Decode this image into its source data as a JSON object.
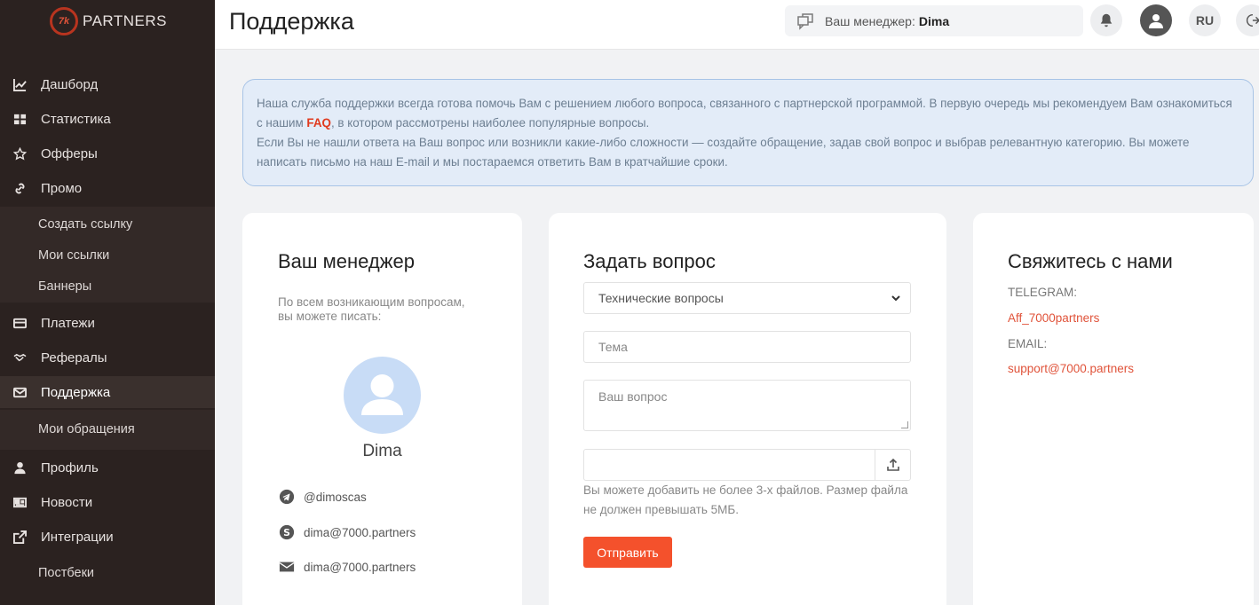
{
  "app": {
    "logo_mark": "7k",
    "logo_text": "PARTNERS"
  },
  "sidebar": {
    "items": [
      {
        "label": "Дашборд",
        "icon": "chart-line-icon"
      },
      {
        "label": "Статистика",
        "icon": "grid-icon"
      },
      {
        "label": "Офферы",
        "icon": "star-icon"
      },
      {
        "label": "Промо",
        "icon": "link-icon"
      },
      {
        "label": "Создать ссылку"
      },
      {
        "label": "Мои ссылки"
      },
      {
        "label": "Баннеры"
      },
      {
        "label": "Платежи",
        "icon": "credit-card-icon"
      },
      {
        "label": "Рефералы",
        "icon": "handshake-icon"
      },
      {
        "label": "Поддержка",
        "icon": "envelope-icon"
      },
      {
        "label": "Мои обращения"
      },
      {
        "label": "Профиль",
        "icon": "user-icon"
      },
      {
        "label": "Новости",
        "icon": "newspaper-icon"
      },
      {
        "label": "Интеграции",
        "icon": "share-icon"
      },
      {
        "label": "Постбеки"
      }
    ]
  },
  "header": {
    "title": "Поддержка",
    "manager_label": "Ваш менеджер:",
    "manager_name": "Dima",
    "lang": "RU"
  },
  "info": {
    "line1_start": "Наша служба поддержки всегда готова помочь Вам с решением любого вопроса, связанного с партнерской программой. В первую очередь мы рекомендуем Вам ознакомиться с нашим ",
    "faq": "FAQ",
    "line1_end": ", в котором рассмотрены наиболее популярные вопросы.",
    "line2": "Если Вы не нашли ответа на Ваш вопрос или возникли какие-либо сложности — создайте обращение, задав свой вопрос и выбрав релевантную категорию. Вы можете написать письмо на наш E-mail и мы постараемся ответить Вам в кратчайшие сроки."
  },
  "manager_card": {
    "title": "Ваш менеджер",
    "subtitle": "По всем возникающим вопросам, вы можете писать:",
    "name": "Dima",
    "telegram": "@dimoscas",
    "skype": "dima@7000.partners",
    "email": "dima@7000.partners"
  },
  "question_card": {
    "title": "Задать вопрос",
    "category_selected": "Технические вопросы",
    "topic_placeholder": "Тема",
    "question_placeholder": "Ваш вопрос",
    "hint": "Вы можете добавить не более 3-х файлов. Размер файла не должен превышать 5МБ.",
    "submit": "Отправить"
  },
  "contact_card": {
    "title": "Свяжитесь с нами",
    "telegram_label": "TELEGRAM:",
    "telegram_value": "Aff_7000partners",
    "email_label": "EMAIL:",
    "email_value": "support@7000.partners"
  },
  "colors": {
    "sidebar_bg": "#2b2220",
    "accent": "#f4512c",
    "link": "#e0533a",
    "info_bg": "#e3ecf8"
  }
}
